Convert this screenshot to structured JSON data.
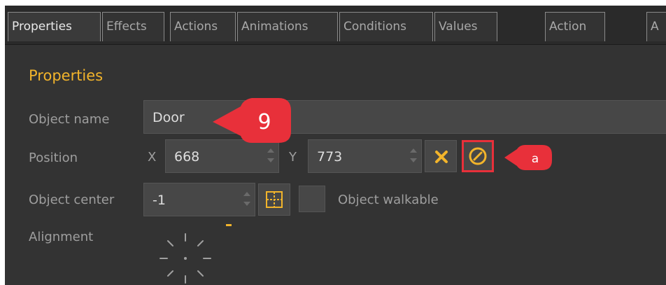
{
  "tabs": [
    {
      "label": "Properties",
      "active": true
    },
    {
      "label": "Effects",
      "active": false
    },
    {
      "label": "Actions",
      "active": false
    },
    {
      "label": "Animations",
      "active": false
    },
    {
      "label": "Conditions",
      "active": false
    },
    {
      "label": "Values",
      "active": false
    },
    {
      "label": "Action",
      "active": false
    },
    {
      "label": "A",
      "active": false
    }
  ],
  "section": {
    "title": "Properties"
  },
  "object_name": {
    "label": "Object name",
    "value": "Door"
  },
  "position": {
    "label": "Position",
    "x_label": "X",
    "x_value": "668",
    "y_label": "Y",
    "y_value": "773",
    "clear_icon": "close-icon",
    "pick_icon": "compass-icon"
  },
  "object_center": {
    "label": "Object center",
    "value": "-1",
    "center_icon": "crosshair-grid-icon"
  },
  "walkable": {
    "label": "Object walkable",
    "checked": false
  },
  "alignment": {
    "label": "Alignment"
  },
  "callouts": {
    "main": "9",
    "secondary": "a"
  },
  "colors": {
    "accent": "#f2b42b",
    "callout": "#e8303a",
    "highlight_border": "#e8303a",
    "panel": "#333333"
  }
}
